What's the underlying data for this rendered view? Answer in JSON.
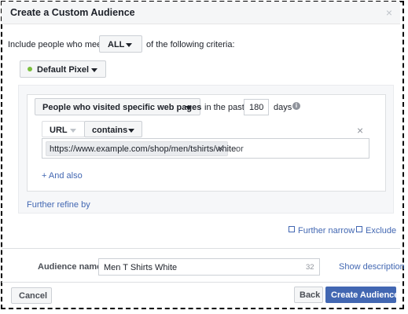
{
  "dialog": {
    "title": "Create a Custom Audience",
    "close_icon": "×"
  },
  "criteria": {
    "prefix": "Include people who meet",
    "match_value": "ALL",
    "suffix": "of the following criteria:"
  },
  "pixel": {
    "label": "Default Pixel",
    "status_color": "#7bbf3e"
  },
  "rule": {
    "visitor_type": "People who visited specific web pages",
    "in_the_past": "in the past",
    "days_value": "180",
    "days_label": "days",
    "info_icon": "i",
    "url_field": "URL",
    "operator": "contains",
    "url_token": "https://www.example.com/shop/men/tshirts/white",
    "token_remove_icon": "×",
    "or_label": "or",
    "remove_rule_icon": "×",
    "add_also": "+ And also"
  },
  "refine": {
    "further_refine": "Further refine by"
  },
  "actions": {
    "further_narrow": "Further narrow",
    "exclude": "Exclude"
  },
  "audience": {
    "name_label": "Audience name",
    "name_value": "Men T Shirts White",
    "char_count": "32",
    "show_description": "Show description"
  },
  "footer": {
    "cancel": "Cancel",
    "back": "Back",
    "create": "Create Audience"
  },
  "colors": {
    "link": "#4267b2",
    "primary": "#4267b2"
  }
}
